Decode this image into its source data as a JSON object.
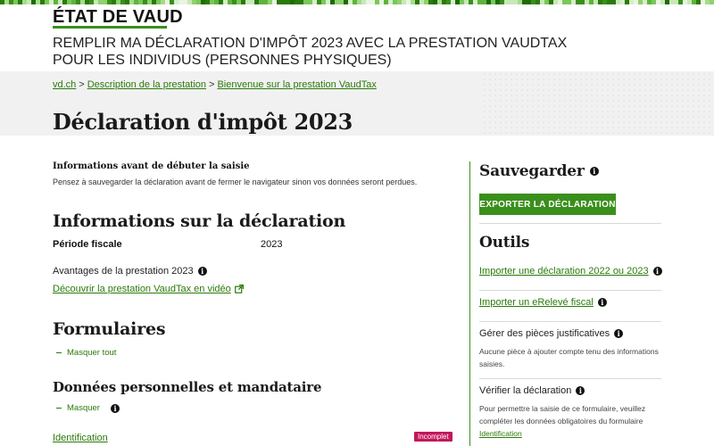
{
  "colors": {
    "brand_green": "#3a8f1c",
    "link_green": "#2b7a0b",
    "badge_incomplete": "#c2185b",
    "pixel_bar": [
      "#c9e8b8",
      "#3a8f1c",
      "#7bc75a",
      "#e8f5e1",
      "#2b7a0b",
      "#a6dc8b",
      "#5fb33c",
      "#d6efc9",
      "#1f6b08",
      "#8fd16e"
    ]
  },
  "header": {
    "brand": "ÉTAT DE VAUD",
    "app_title": "REMPLIR MA DÉCLARATION D'IMPÔT 2023 AVEC LA PRESTATION VAUDTAX POUR LES INDIVIDUS (PERSONNES PHYSIQUES)"
  },
  "breadcrumb": {
    "items": [
      "vd.ch",
      "Description de la prestation",
      "Bienvenue sur la prestation VaudTax"
    ],
    "separator": ">"
  },
  "page_title": "Déclaration d'impôt 2023",
  "notice": {
    "heading": "Informations avant de débuter la saisie",
    "text": "Pensez à sauvegarder la déclaration avant de fermer le navigateur sinon vos données seront perdues."
  },
  "declaration": {
    "title": "Informations sur la déclaration",
    "period_label": "Période fiscale",
    "period_value": "2023",
    "advantages_label": "Avantages de la prestation 2023",
    "video_link": "Découvrir la prestation VaudTax en vidéo"
  },
  "forms": {
    "title": "Formulaires",
    "hide_all": "Masquer tout",
    "personal_title": "Données personnelles et mandataire",
    "hide": "Masquer",
    "identification_link": "Identification",
    "identification_status": "Incomplet"
  },
  "sidebar": {
    "save_title": "Sauvegarder",
    "export_button": "EXPORTER LA DÉCLARATION",
    "tools_title": "Outils",
    "import_link": "Importer une déclaration 2022 ou 2023",
    "erelev_link": "Importer un eRelevé fiscal",
    "pieces_title": "Gérer des pièces justificatives",
    "pieces_note": "Aucune pièce à ajouter compte tenu des informations saisies.",
    "verify_title": "Vérifier la déclaration",
    "verify_note": "Pour permettre la saisie de ce formulaire, veuillez compléter les données obligatoires du formulaire",
    "verify_link": "Identification"
  },
  "icons": {
    "info": "info-icon",
    "external": "external-link-icon",
    "collapse": "minus-icon"
  }
}
